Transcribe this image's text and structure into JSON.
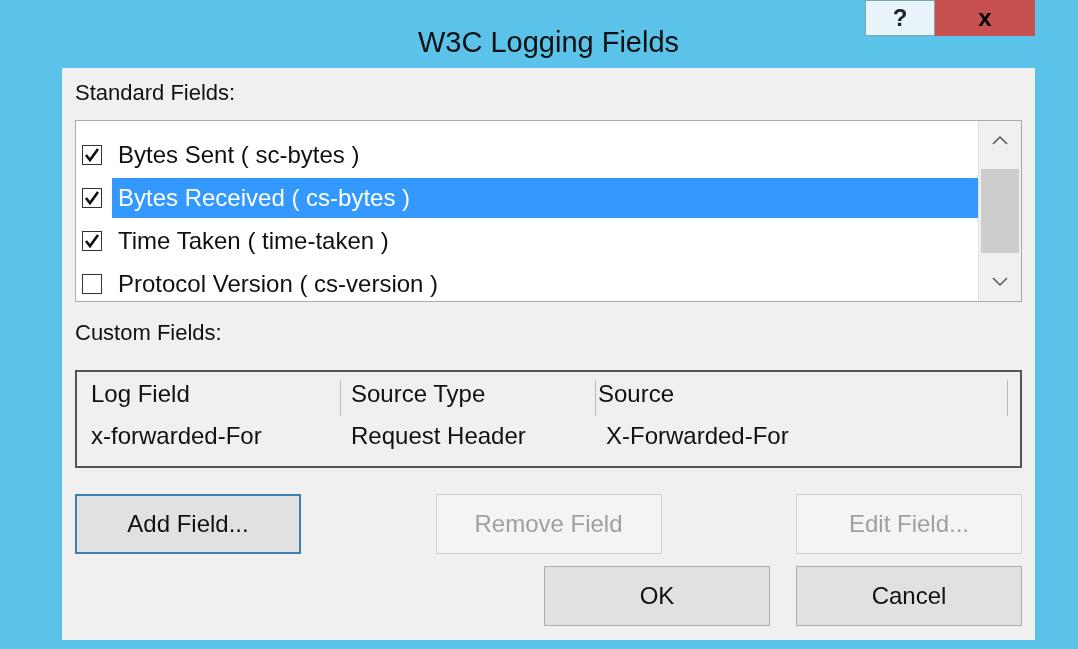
{
  "window": {
    "title": "W3C Logging Fields",
    "help_button": "?",
    "close_button": "x"
  },
  "standard_fields": {
    "label": "Standard Fields:",
    "items": [
      {
        "label": "Bytes Sent ( sc-bytes )",
        "checked": true,
        "selected": false
      },
      {
        "label": "Bytes Received ( cs-bytes )",
        "checked": true,
        "selected": true
      },
      {
        "label": "Time Taken ( time-taken )",
        "checked": true,
        "selected": false
      },
      {
        "label": "Protocol Version ( cs-version )",
        "checked": false,
        "selected": false
      }
    ]
  },
  "custom_fields": {
    "label": "Custom Fields:",
    "columns": [
      "Log Field",
      "Source Type",
      "Source"
    ],
    "rows": [
      [
        "x-forwarded-For",
        "Request Header",
        "X-Forwarded-For"
      ]
    ]
  },
  "field_buttons": [
    {
      "label": "Add Field...",
      "disabled": false,
      "focused": true
    },
    {
      "label": "Remove Field",
      "disabled": true,
      "focused": false
    },
    {
      "label": "Edit Field...",
      "disabled": true,
      "focused": false
    }
  ],
  "dialog_buttons": [
    {
      "label": "OK",
      "disabled": false,
      "focused": false
    },
    {
      "label": "Cancel",
      "disabled": false,
      "focused": false
    }
  ]
}
